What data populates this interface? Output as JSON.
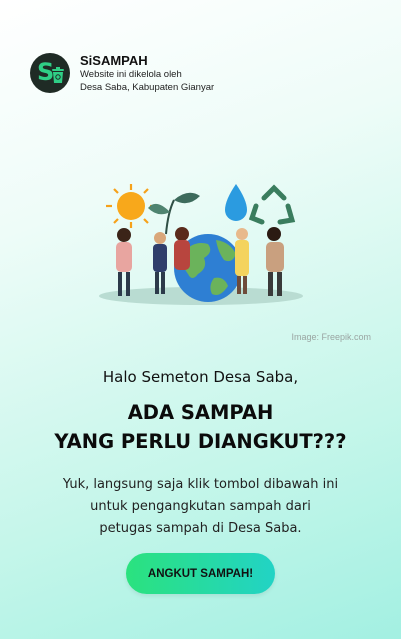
{
  "header": {
    "logo_letter": "S",
    "title": "SiSAMPAH",
    "subtitle_line1": "Website ini dikelola oleh",
    "subtitle_line2": "Desa Saba, Kabupaten Gianyar"
  },
  "hero": {
    "image_credit": "Image: Freepik.com",
    "illustration_icons": [
      "sun-icon",
      "plant-icon",
      "water-drop-icon",
      "recycle-icon",
      "earth-globe-icon"
    ]
  },
  "content": {
    "greeting": "Halo Semeton Desa Saba,",
    "headline_line1": "ADA SAMPAH",
    "headline_line2": "YANG PERLU DIANGKUT???",
    "desc_line1": "Yuk, langsung saja klik tombol dibawah ini",
    "desc_line2": "untuk pengangkutan sampah dari",
    "desc_line3": "petugas sampah di Desa Saba."
  },
  "cta": {
    "label": "ANGKUT SAMPAH!"
  },
  "colors": {
    "accent_start": "#2be27e",
    "accent_end": "#22d3c5",
    "logo_bg": "#1f2b25",
    "logo_fg": "#2fcf86"
  }
}
